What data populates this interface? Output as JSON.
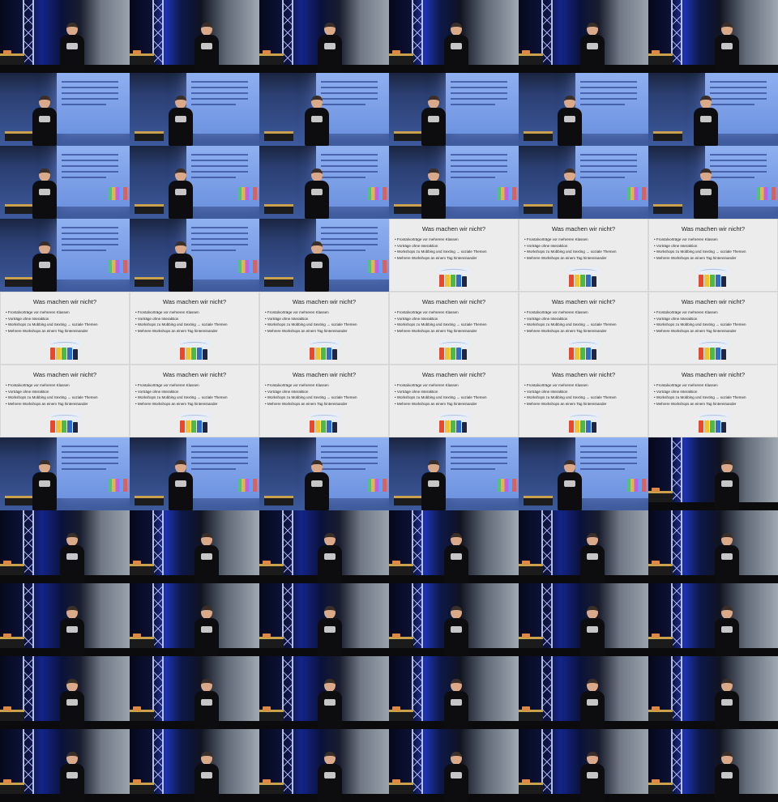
{
  "contact_sheet": {
    "columns": 6,
    "rows": 11,
    "slide": {
      "title": "Was machen wir nicht?",
      "bullets": [
        "Frontalvorträge vor mehreren Klassen",
        "Vorträge ohne Interaktion",
        "Workshops zu Mobbing und Sexting → soziale Themen",
        "Mehrere Workshops an einem Tag hintereinander"
      ]
    },
    "row_scenes": [
      "stage",
      "projection",
      "projection",
      "projection-mixed",
      "slide",
      "slide",
      "projection-mixed2",
      "stage",
      "stage",
      "stage",
      "stage"
    ],
    "colors": {
      "stage_blue": "#14258a",
      "slide_background": "#ececec",
      "projection_blue": "#6e93e0"
    }
  }
}
